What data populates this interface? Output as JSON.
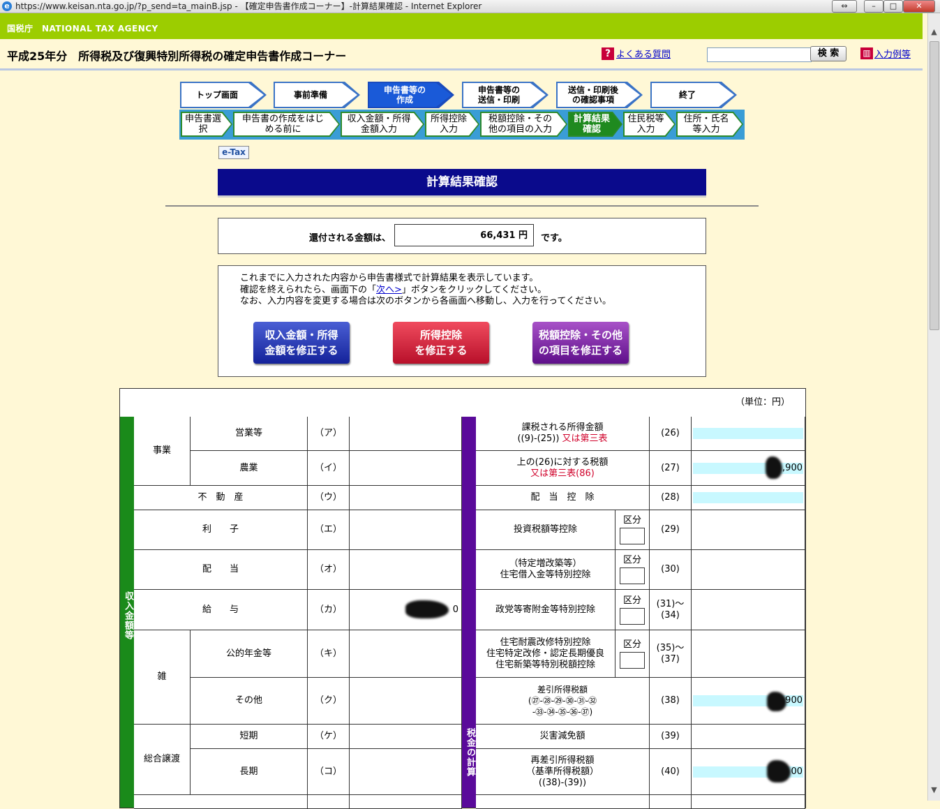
{
  "window": {
    "title": "https://www.keisan.nta.go.jp/?p_send=ta_mainB.jsp - 【確定申告書作成コーナー】-計算結果確認 - Internet Explorer",
    "ie_icon": "e"
  },
  "header": {
    "agency": "国税庁　NATIONAL TAX AGENCY",
    "title": "平成25年分　所得税及び復興特別所得税の確定申告書作成コーナー",
    "faq_label": "よくある質問",
    "search_value": "",
    "search_button": "検 索",
    "input_examples": "入力例等"
  },
  "progress": {
    "steps": [
      "トップ画面",
      "事前準備",
      "申告書等の作成",
      "申告書等の送信・印刷",
      "送信・印刷後の確認事項",
      "終了"
    ],
    "step_lines": [
      [
        "トップ画面"
      ],
      [
        "事前準備"
      ],
      [
        "申告書等の",
        "作成"
      ],
      [
        "申告書等の",
        "送信・印刷"
      ],
      [
        "送信・印刷後",
        "の確認事項"
      ],
      [
        "終了"
      ]
    ],
    "substeps": [
      [
        "申告書選",
        "択"
      ],
      [
        "申告書の作成をはじ",
        "める前に"
      ],
      [
        "収入金額・所得",
        "金額入力"
      ],
      [
        "所得控除",
        "入力"
      ],
      [
        "税額控除・その",
        "他の項目の入力"
      ],
      [
        "計算結果",
        "確認"
      ],
      [
        "住民税等",
        "入力"
      ],
      [
        "住所・氏名",
        "等入力"
      ]
    ]
  },
  "etax": "e-Tax",
  "page_title": "計算結果確認",
  "refund": {
    "label": "還付される金額は、",
    "amount": "66,431 円",
    "suffix": "です。"
  },
  "info": {
    "line1": "これまでに入力された内容から申告書様式で計算結果を表示しています。",
    "line2_pre": "確認を終えられたら、画面下の「",
    "line2_link": "次へ>",
    "line2_post": "」ボタンをクリックしてください。",
    "line3": "なお、入力内容を変更する場合は次のボタンから各画面へ移動し、入力を行ってください。",
    "buttons": [
      [
        "収入金額・所得",
        "金額を修正する"
      ],
      [
        "所得控除",
        "を修正する"
      ],
      [
        "税額控除・その他",
        "の項目を修正する"
      ]
    ]
  },
  "table": {
    "unit": "（単位：円）",
    "left_section": "収入金額等",
    "right_section": "税金の計算",
    "kubun": "区分",
    "left": {
      "jigyo": "事業",
      "eigyo": "営業等",
      "eigyo_code": "（ア）",
      "nogyo": "農業",
      "nogyo_code": "（イ）",
      "fudosan": "不　動　産",
      "fudosan_code": "（ウ）",
      "rishi": "利　　子",
      "rishi_code": "（エ）",
      "haito": "配　　当",
      "haito_code": "（オ）",
      "kyuyo": "給　　与",
      "kyuyo_code": "（カ）",
      "kyuyo_amount_tail": "0",
      "zatsu": "雑",
      "nenkin": "公的年金等",
      "nenkin_code": "（キ）",
      "sonota": "その他",
      "sonota_code": "（ク）",
      "sogo": "総合譲渡",
      "tanki": "短期",
      "tanki_code": "（ケ）",
      "choki": "長期",
      "choki_code": "（コ）"
    },
    "right": {
      "r26_a": "課税される所得金額",
      "r26_b": "((9)-(25))",
      "r26_c": "又は第三表",
      "r26_code": "(26)",
      "r27_a": "上の(26)に対する税額",
      "r27_b": "又は第三表(86)",
      "r27_code": "(27)",
      "r27_amount_tail": ",900",
      "r28": "配　当　控　除",
      "r28_code": "(28)",
      "r29": "投資税額等控除",
      "r29_code": "(29)",
      "r30_a": "（特定増改築等）",
      "r30_b": "住宅借入金等特別控除",
      "r30_code": "(30)",
      "r31": "政党等寄附金等特別控除",
      "r31_code_a": "(31)～",
      "r31_code_b": "(34)",
      "r35_a": "住宅耐震改修特別控除",
      "r35_b": "住宅特定改修・認定長期優良",
      "r35_c": "住宅新築等特別税額控除",
      "r35_code_a": "(35)～",
      "r35_code_b": "(37)",
      "r38_a": "差引所得税額",
      "r38_b": "(㉗-㉘-㉙-㉚-㉛-㉜",
      "r38_c": "-㉝-㉞-㉟-㊱-㊲)",
      "r38_code": "(38)",
      "r38_amount_tail": "900",
      "r39": "災害減免額",
      "r39_code": "(39)",
      "r40_a": "再差引所得税額",
      "r40_b": "（基準所得税額）",
      "r40_c": "((38)-(39))",
      "r40_code": "(40)",
      "r40_amount_tail": "00"
    }
  },
  "colors": {
    "agency_bar": "#9ccd00",
    "page_bg": "#fff8d6",
    "title_bar": "#0a0a8c",
    "left_band": "#1a8a1a",
    "right_band": "#5a0a9a",
    "amount_field": "#c8f8ff"
  }
}
